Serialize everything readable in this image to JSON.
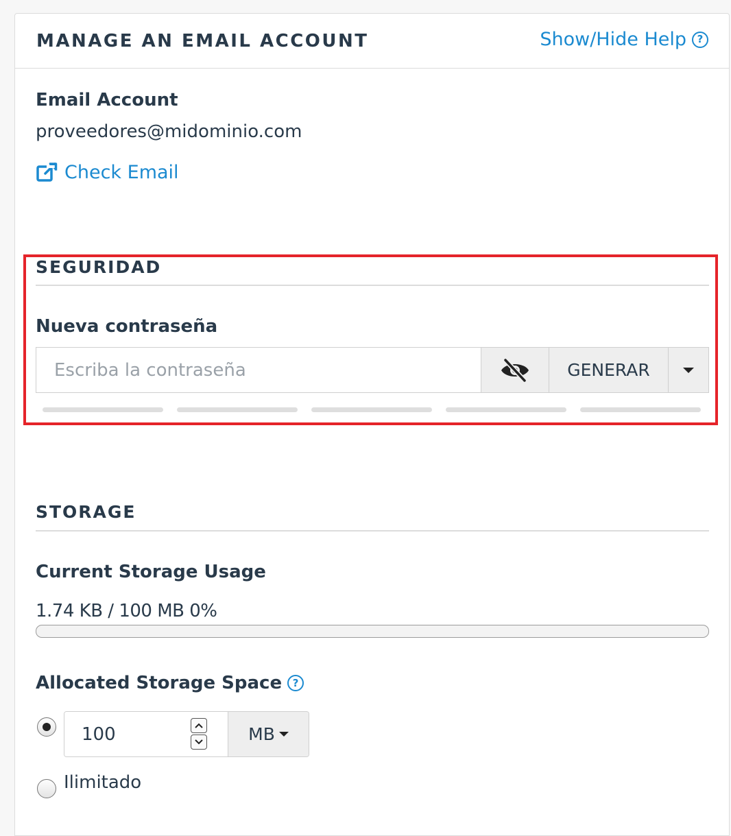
{
  "header": {
    "title": "MANAGE AN EMAIL ACCOUNT",
    "help_label": "Show/Hide Help",
    "help_icon_glyph": "?"
  },
  "account": {
    "label": "Email Account",
    "value": "proveedores@midominio.com",
    "check_email_label": "Check Email"
  },
  "security": {
    "section_title": "SEGURIDAD",
    "password_label": "Nueva contraseña",
    "password_placeholder": "Escriba la contraseña",
    "password_value": "",
    "generate_label": "GENERAR",
    "strength_segments": 5
  },
  "storage": {
    "section_title": "STORAGE",
    "usage_label": "Current Storage Usage",
    "usage_text": "1.74 KB / 100 MB 0%",
    "usage_percent": 0,
    "allocated_label": "Allocated Storage Space",
    "allocated_help_glyph": "?",
    "quota_value": "100",
    "quota_unit": "MB",
    "unlimited_label": "Ilimitado",
    "selected_option": "quota"
  },
  "colors": {
    "link": "#1b8ad0",
    "highlight": "#e5242a",
    "text": "#293a4a",
    "addon_bg": "#eeeeee"
  },
  "icons": {
    "external_link": "external-link-icon",
    "eye_slash": "eye-slash-icon",
    "dropdown_caret": "caret-down-icon",
    "help": "question-circle-icon"
  }
}
